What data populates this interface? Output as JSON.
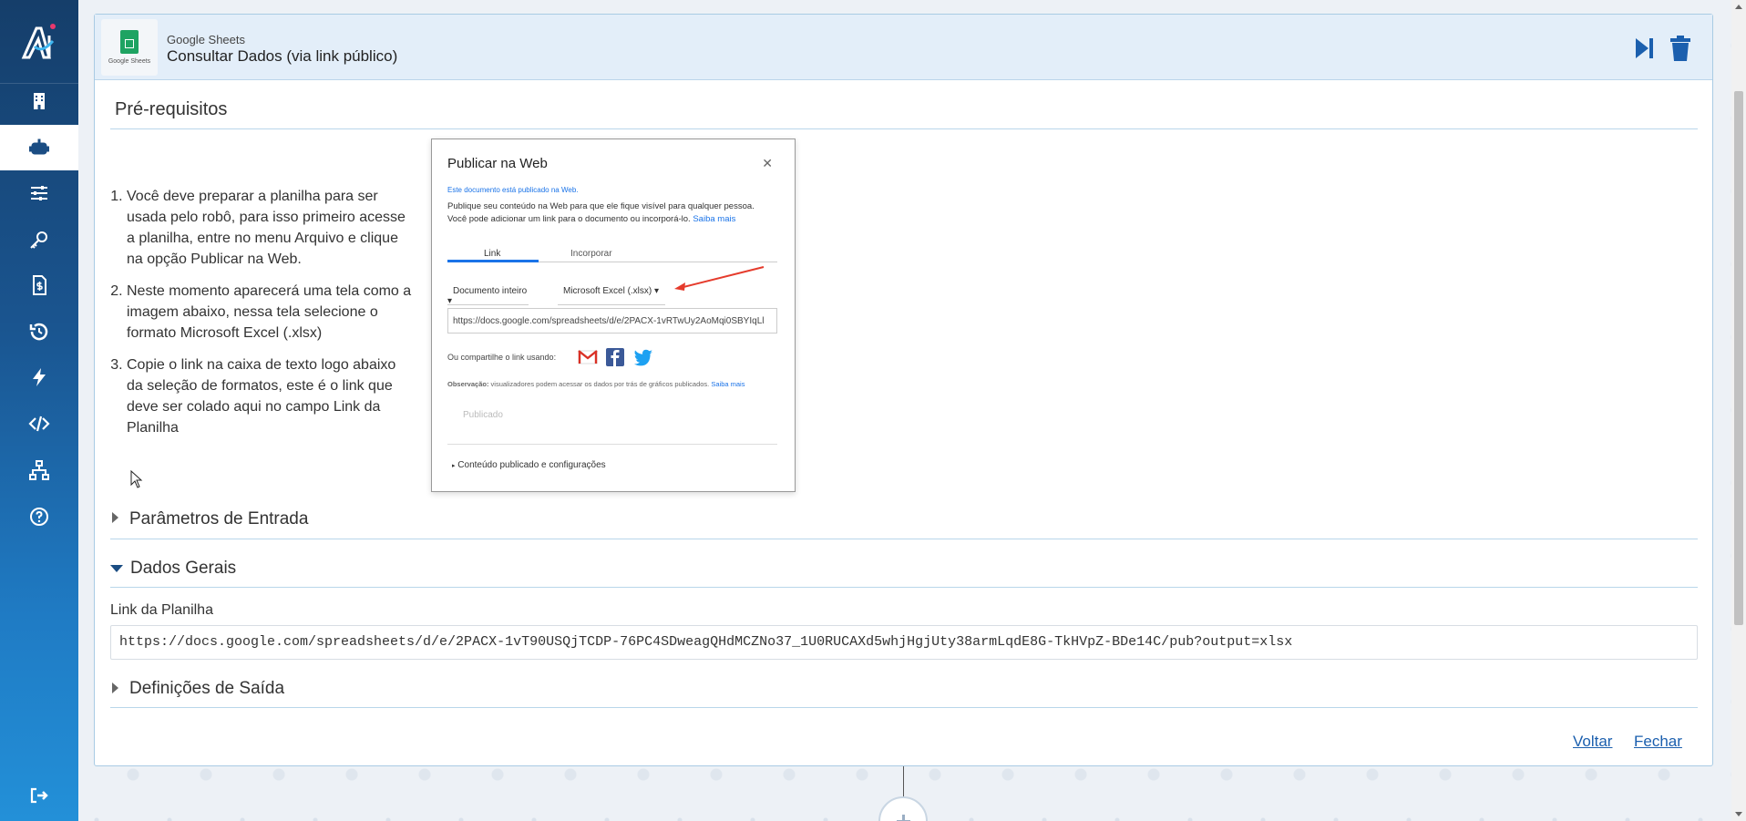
{
  "sidebar": {
    "items": [
      {
        "name": "building-icon"
      },
      {
        "name": "robot-icon",
        "active": true
      },
      {
        "name": "sliders-icon"
      },
      {
        "name": "key-icon"
      },
      {
        "name": "invoice-icon"
      },
      {
        "name": "history-icon"
      },
      {
        "name": "bolt-icon"
      },
      {
        "name": "code-icon"
      },
      {
        "name": "sitemap-icon"
      },
      {
        "name": "help-icon"
      },
      {
        "name": "logout-icon"
      }
    ]
  },
  "header": {
    "logo_caption": "Google Sheets",
    "subtitle": "Google Sheets",
    "title": "Consultar Dados (via link público)"
  },
  "prerequisites": {
    "title": "Pré-requisitos",
    "steps": [
      "Você deve preparar a planilha para ser usada pelo robô, para isso primeiro acesse a planilha, entre no menu Arquivo e clique na opção Publicar na Web.",
      "Neste momento aparecerá uma tela como a imagem abaixo, nessa tela selecione o formato Microsoft Excel (.xlsx)",
      "Copie o link na caixa de texto logo abaixo da seleção de formatos, este é o link que deve ser colado aqui no campo Link da Planilha"
    ],
    "screenshot": {
      "title": "Publicar na Web",
      "published_note": "Este documento está publicado na Web.",
      "desc_line1": "Publique seu conteúdo na Web para que ele fique visível para qualquer pessoa.",
      "desc_line2": "Você pode adicionar um link para o documento ou incorporá-lo.",
      "learn_more": "Saiba mais",
      "tab_link": "Link",
      "tab_embed": "Incorporar",
      "dropdown_doc": "Documento inteiro",
      "dropdown_format": "Microsoft Excel (.xlsx)",
      "url": "https://docs.google.com/spreadsheets/d/e/2PACX-1vRTwUy2AoMqi0SBYIqLl",
      "share_label": "Ou compartilhe o link usando:",
      "obs_label": "Observação:",
      "obs_text": "visualizadores podem acessar os dados por trás de gráficos publicados.",
      "obs_more": "Saiba mais",
      "published_btn": "Publicado",
      "content_settings": "Conteúdo publicado e configurações"
    }
  },
  "sections": {
    "input_params": "Parâmetros de Entrada",
    "general_data": "Dados Gerais",
    "output_defs": "Definições de Saída"
  },
  "form": {
    "sheet_link_label": "Link da Planilha",
    "sheet_link_value": "https://docs.google.com/spreadsheets/d/e/2PACX-1vT90USQjTCDP-76PC4SDweagQHdMCZNo37_1U0RUCAXd5whjHgjUty38armLqdE8G-TkHVpZ-BDe14C/pub?output=xlsx"
  },
  "footer": {
    "back": "Voltar",
    "close": "Fechar"
  },
  "colors": {
    "sidebar_top": "#153e6a",
    "sidebar_bottom": "#2390d8",
    "header_bg": "#e3eef9",
    "link": "#1b5fae",
    "sheets_green": "#1ea362"
  }
}
